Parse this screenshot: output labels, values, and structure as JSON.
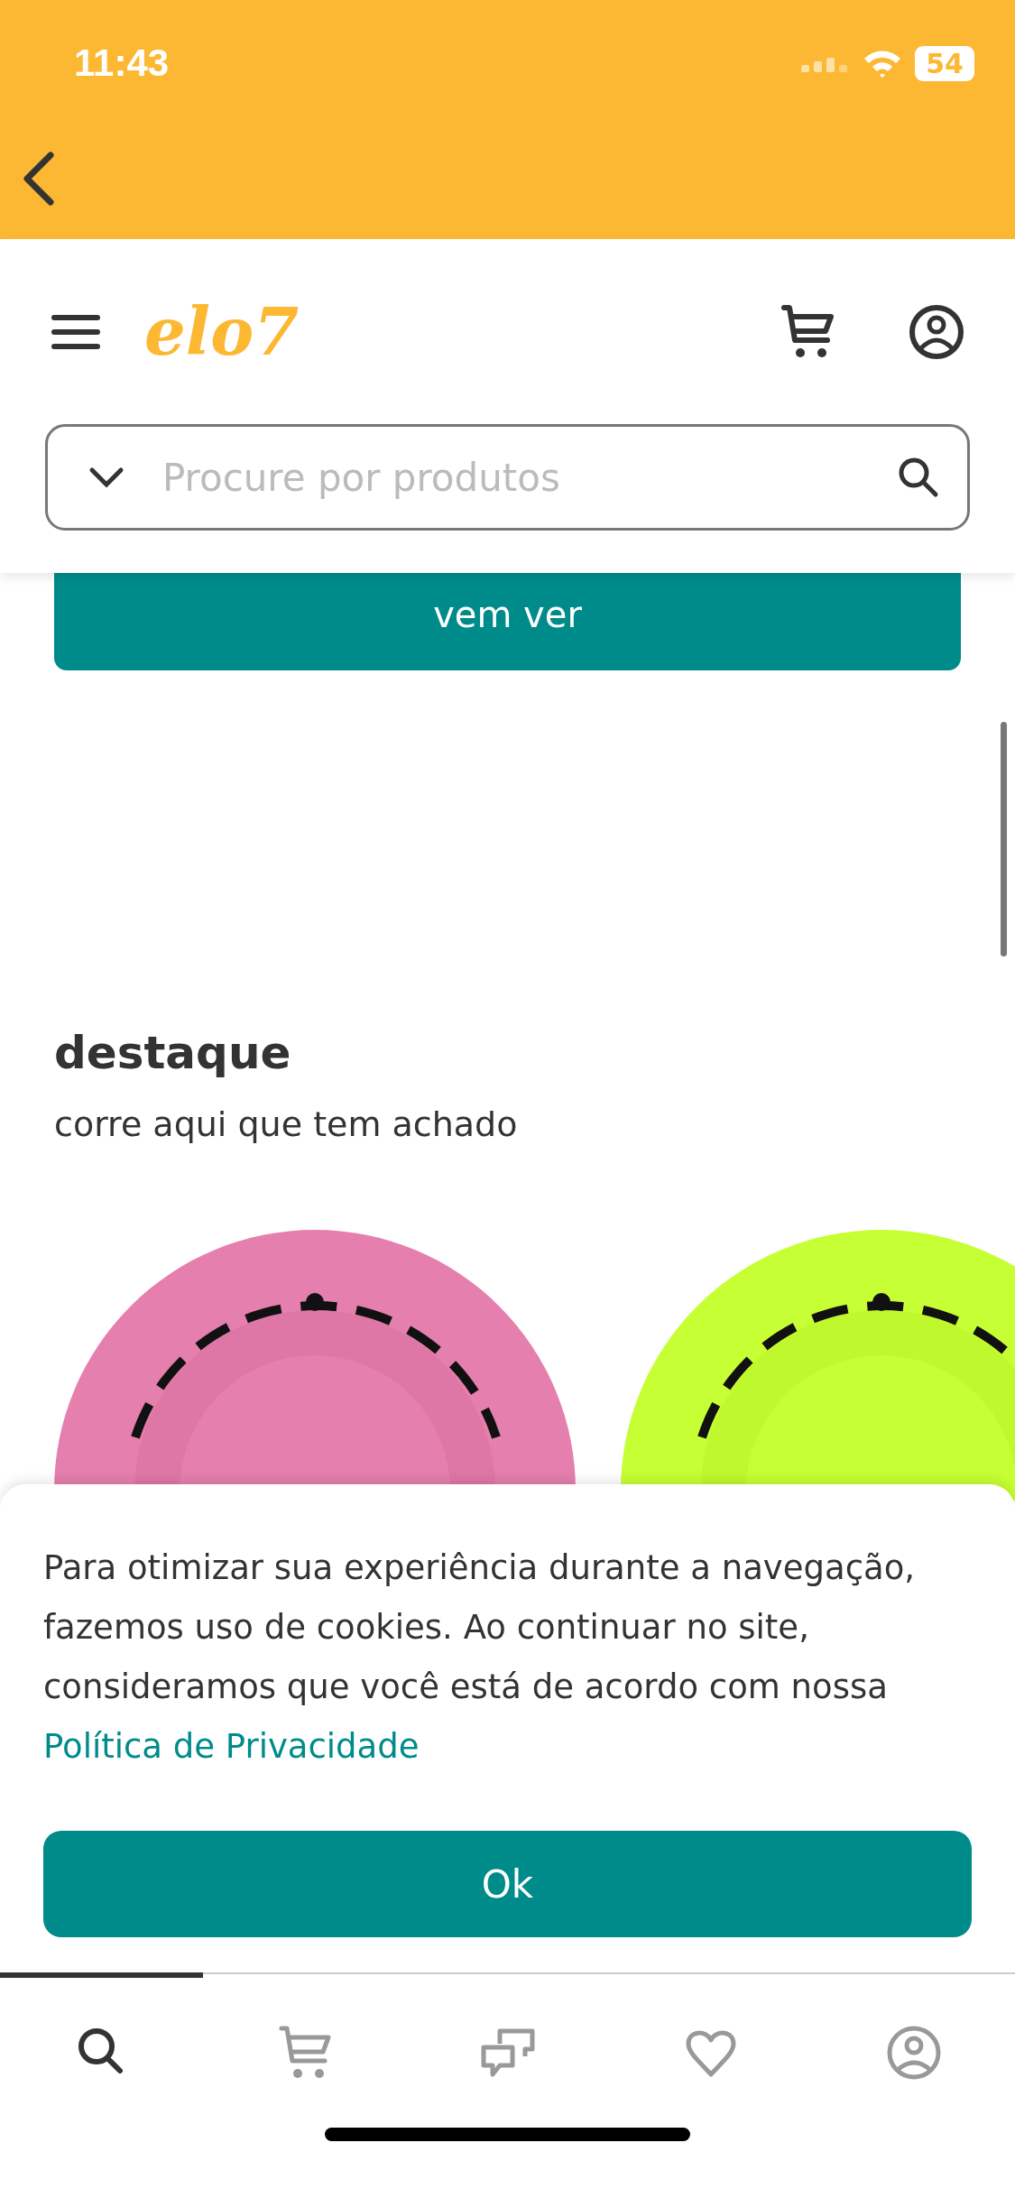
{
  "status_bar": {
    "time": "11:43",
    "battery": "54"
  },
  "header": {
    "logo": "elo7",
    "search": {
      "placeholder": "Procure por produtos"
    }
  },
  "banner_button": {
    "label": "vem ver"
  },
  "section": {
    "title": "destaque",
    "subtitle": "corre aqui que tem achado"
  },
  "cookie_notice": {
    "text": "Para otimizar sua experiência durante a navegação, fazemos uso de cookies. Ao continuar no site, consideramos que você está de acordo com nossa",
    "link": "Política de Privacidade",
    "button": "Ok"
  },
  "bottom_nav": [
    {
      "selected": true
    },
    {
      "selected": false
    },
    {
      "selected": false
    },
    {
      "selected": false
    },
    {
      "selected": false
    }
  ]
}
